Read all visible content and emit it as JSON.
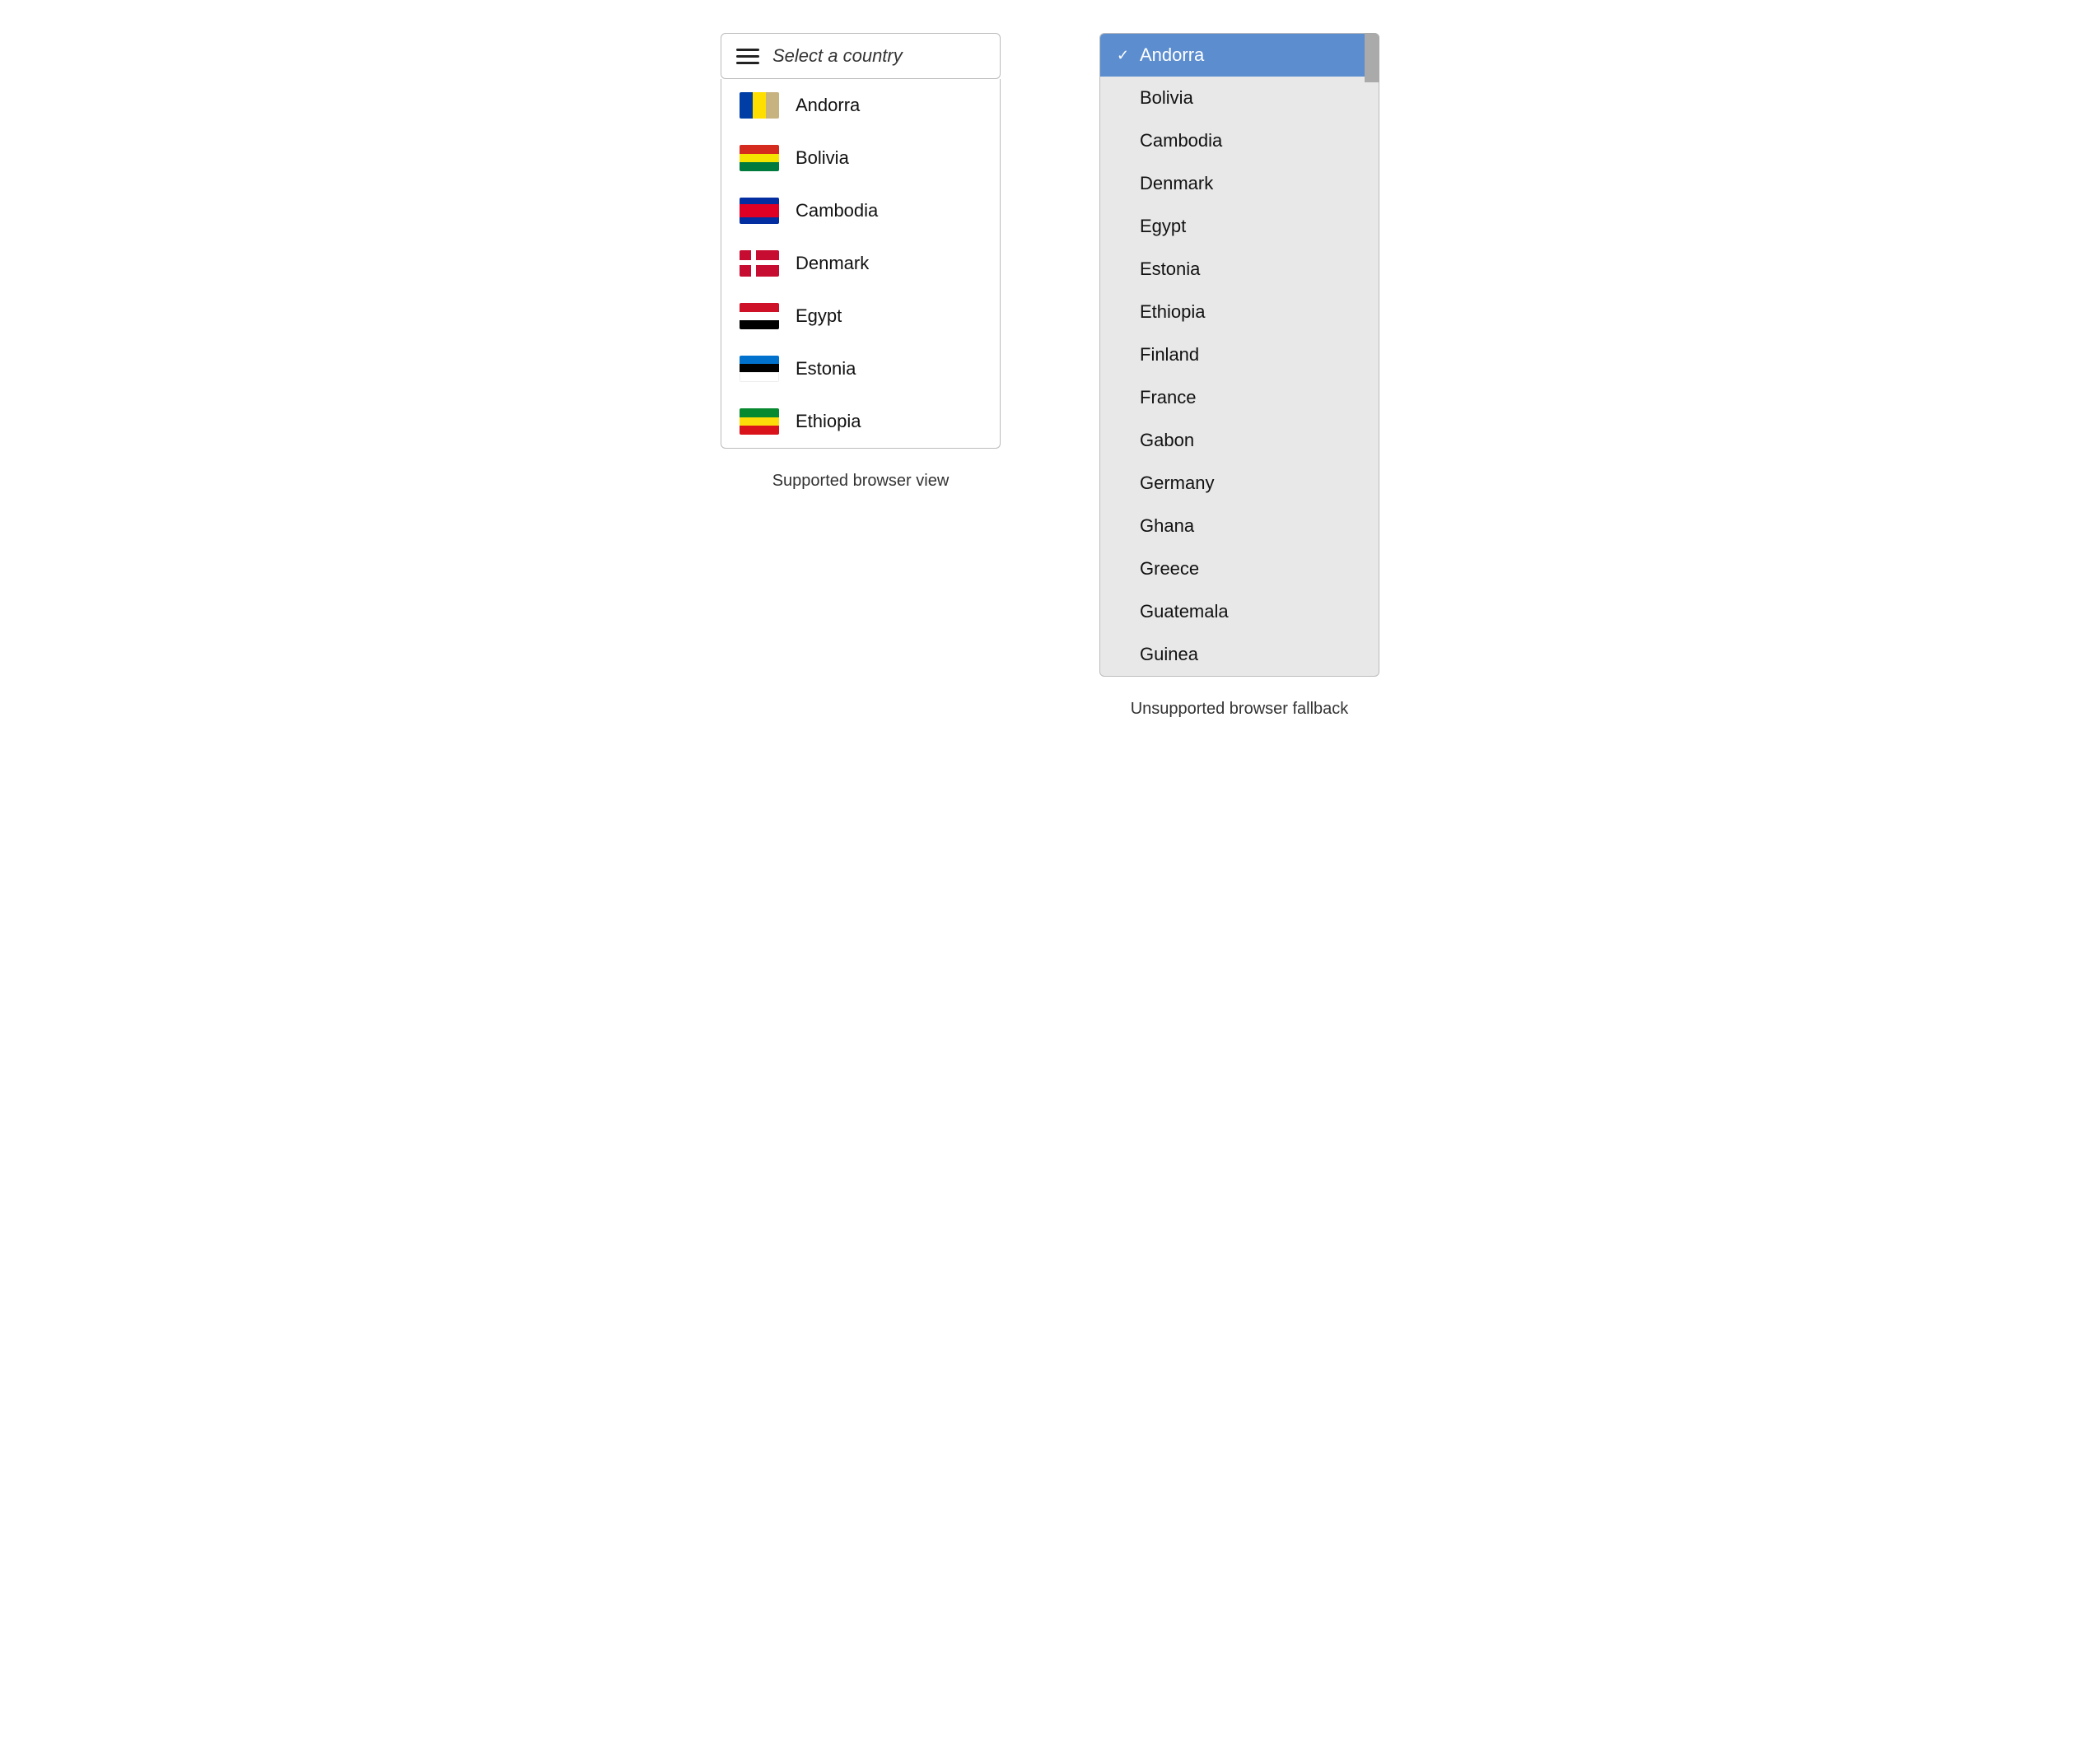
{
  "left": {
    "trigger_placeholder": "Select a country",
    "label": "Supported browser view",
    "items": [
      {
        "id": "andorra",
        "name": "Andorra",
        "flag_type": "andorra"
      },
      {
        "id": "bolivia",
        "name": "Bolivia",
        "flag_type": "bolivia"
      },
      {
        "id": "cambodia",
        "name": "Cambodia",
        "flag_type": "cambodia"
      },
      {
        "id": "denmark",
        "name": "Denmark",
        "flag_type": "denmark"
      },
      {
        "id": "egypt",
        "name": "Egypt",
        "flag_type": "egypt"
      },
      {
        "id": "estonia",
        "name": "Estonia",
        "flag_type": "estonia"
      },
      {
        "id": "ethiopia",
        "name": "Ethiopia",
        "flag_type": "ethiopia"
      }
    ]
  },
  "right": {
    "label": "Unsupported browser fallback",
    "selected": "Andorra",
    "items": [
      "Andorra",
      "Bolivia",
      "Cambodia",
      "Denmark",
      "Egypt",
      "Estonia",
      "Ethiopia",
      "Finland",
      "France",
      "Gabon",
      "Germany",
      "Ghana",
      "Greece",
      "Guatemala",
      "Guinea"
    ]
  }
}
